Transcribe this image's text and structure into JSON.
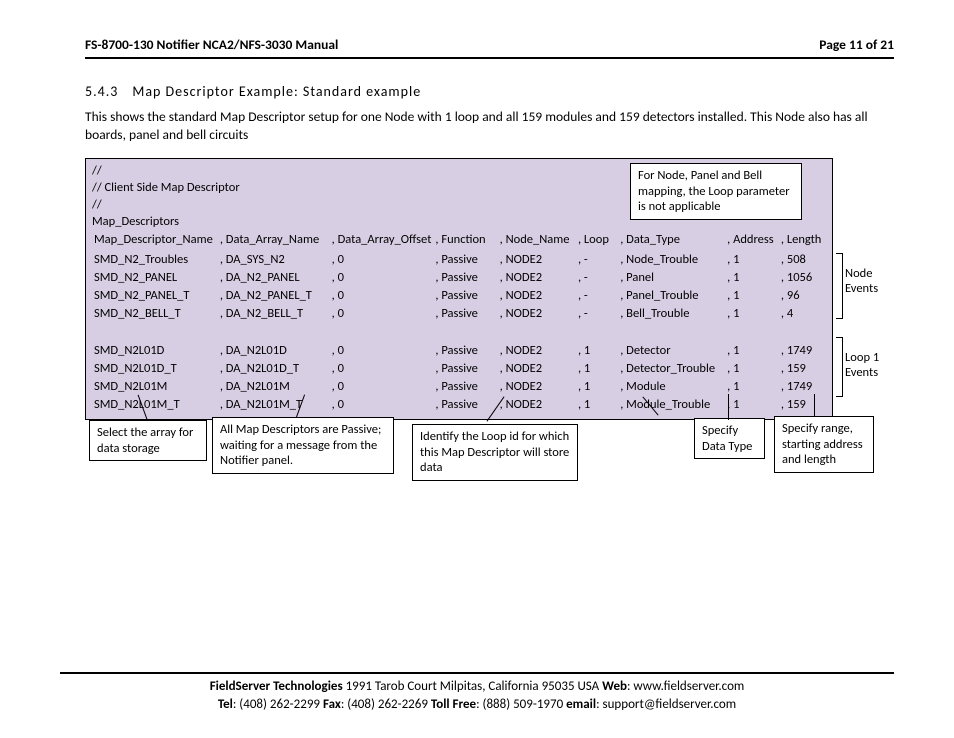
{
  "header": {
    "title": "FS-8700-130 Notifier NCA2/NFS-3030 Manual",
    "page": "Page 11 of 21"
  },
  "section": {
    "num": "5.4.3",
    "title": "Map Descriptor Example: Standard example"
  },
  "intro": "This shows the standard Map Descriptor setup for one Node with 1 loop and all 159 modules and 159 detectors installed.  This Node also has all boards, panel and bell circuits",
  "comments": [
    "//",
    "// Client Side Map Descriptor",
    "//",
    "Map_Descriptors"
  ],
  "columns": [
    "Map_Descriptor_Name",
    ", Data_Array_Name",
    ", Data_Array_Offset",
    ", Function",
    ", Node_Name",
    ", Loop",
    ", Data_Type",
    ", Address",
    ", Length"
  ],
  "rows_a": [
    [
      "SMD_N2_Troubles",
      ", DA_SYS_N2",
      ", 0",
      ", Passive",
      ", NODE2",
      ", -",
      ", Node_Trouble",
      ", 1",
      ", 508"
    ],
    [
      "SMD_N2_PANEL",
      ", DA_N2_PANEL",
      ", 0",
      ", Passive",
      ", NODE2",
      ", -",
      ", Panel",
      ", 1",
      ", 1056"
    ],
    [
      "SMD_N2_PANEL_T",
      ", DA_N2_PANEL_T",
      ", 0",
      ", Passive",
      ", NODE2",
      ", -",
      ", Panel_Trouble",
      ", 1",
      ", 96"
    ],
    [
      "SMD_N2_BELL_T",
      ", DA_N2_BELL_T",
      ", 0",
      ", Passive",
      ", NODE2",
      ", -",
      ", Bell_Trouble",
      ", 1",
      ", 4"
    ]
  ],
  "rows_b": [
    [
      "SMD_N2L01D",
      ", DA_N2L01D",
      ", 0",
      ", Passive",
      ", NODE2",
      ", 1",
      ", Detector",
      ", 1",
      ", 1749"
    ],
    [
      "SMD_N2L01D_T",
      ", DA_N2L01D_T",
      ", 0",
      ", Passive",
      ", NODE2",
      ", 1",
      ", Detector_Trouble",
      ", 1",
      ", 159"
    ],
    [
      "SMD_N2L01M",
      ", DA_N2L01M",
      ", 0",
      ", Passive",
      ", NODE2",
      ", 1",
      ", Module",
      ", 1",
      ", 1749"
    ],
    [
      "SMD_N2L01M_T",
      ", DA_N2L01M_T",
      ", 0",
      ", Passive",
      ", NODE2",
      ", 1",
      ", Module_Trouble",
      ", 1",
      ", 159"
    ]
  ],
  "side": {
    "a": "Node Events",
    "b": "Loop 1 Events"
  },
  "callouts": {
    "top": "For Node, Panel and Bell mapping, the Loop parameter is not applicable",
    "sel": "Select the array for data storage",
    "pass": "All Map Descriptors are Passive; waiting for a message from the Notifier panel.",
    "loop": "Identify the Loop id for which this Map Descriptor will store data",
    "type": "Specify Data Type",
    "range": "Specify range, starting address and length"
  },
  "footer": {
    "line1a": "FieldServer Technologies",
    "line1b": " 1991 Tarob Court Milpitas, California 95035 USA  ",
    "line1c": "Web",
    "line1d": ": www.fieldserver.com",
    "line2a": "Tel",
    "line2b": ": (408) 262-2299  ",
    "line2c": "Fax",
    "line2d": ": (408) 262-2269  ",
    "line2e": "Toll Free",
    "line2f": ": (888) 509-1970  ",
    "line2g": "email",
    "line2h": ": support@fieldserver.com"
  }
}
